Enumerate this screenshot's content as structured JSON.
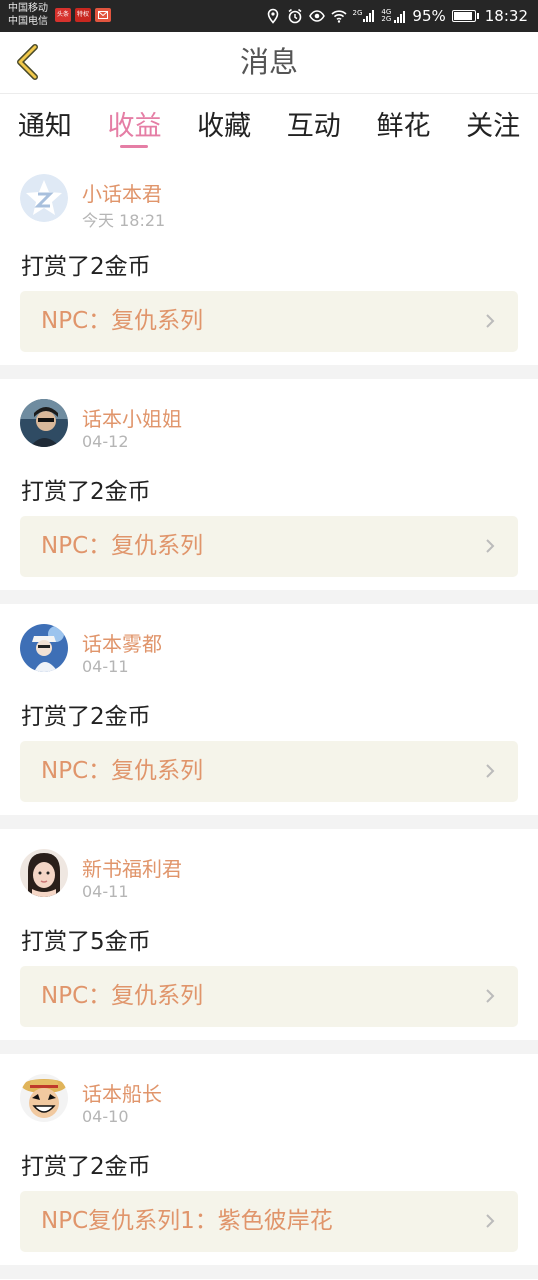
{
  "status_bar": {
    "carrier_1": "中国移动",
    "carrier_2": "中国电信",
    "app_badges": [
      "头条",
      "特权",
      ""
    ],
    "network_1": "2G",
    "network_2": "4G 2G",
    "battery": "95%",
    "battery_level": 0.95,
    "time": "18:32"
  },
  "header": {
    "title": "消息"
  },
  "tabs": [
    {
      "label": "通知",
      "active": false
    },
    {
      "label": "收益",
      "active": true
    },
    {
      "label": "收藏",
      "active": false
    },
    {
      "label": "互动",
      "active": false
    },
    {
      "label": "鲜花",
      "active": false
    },
    {
      "label": "关注",
      "active": false
    }
  ],
  "items": [
    {
      "user": "小话本君",
      "date": "今天 18:21",
      "action": "打赏了2金币",
      "book": "NPC：复仇系列",
      "avatar": "star-logo-avatar"
    },
    {
      "user": "话本小姐姐",
      "date": "04-12",
      "action": "打赏了2金币",
      "book": "NPC：复仇系列",
      "avatar": "portrait-avatar"
    },
    {
      "user": "话本雾都",
      "date": "04-11",
      "action": "打赏了2金币",
      "book": "NPC：复仇系列",
      "avatar": "anime-avatar"
    },
    {
      "user": "新书福利君",
      "date": "04-11",
      "action": "打赏了5金币",
      "book": "NPC：复仇系列",
      "avatar": "girl-avatar"
    },
    {
      "user": "话本船长",
      "date": "04-10",
      "action": "打赏了2金币",
      "book": "NPC复仇系列1：紫色彼岸花",
      "avatar": "pirate-avatar"
    }
  ],
  "colors": {
    "accent": "#e57ea5",
    "name": "#e0956b",
    "book_bg": "#f5f4ea"
  }
}
